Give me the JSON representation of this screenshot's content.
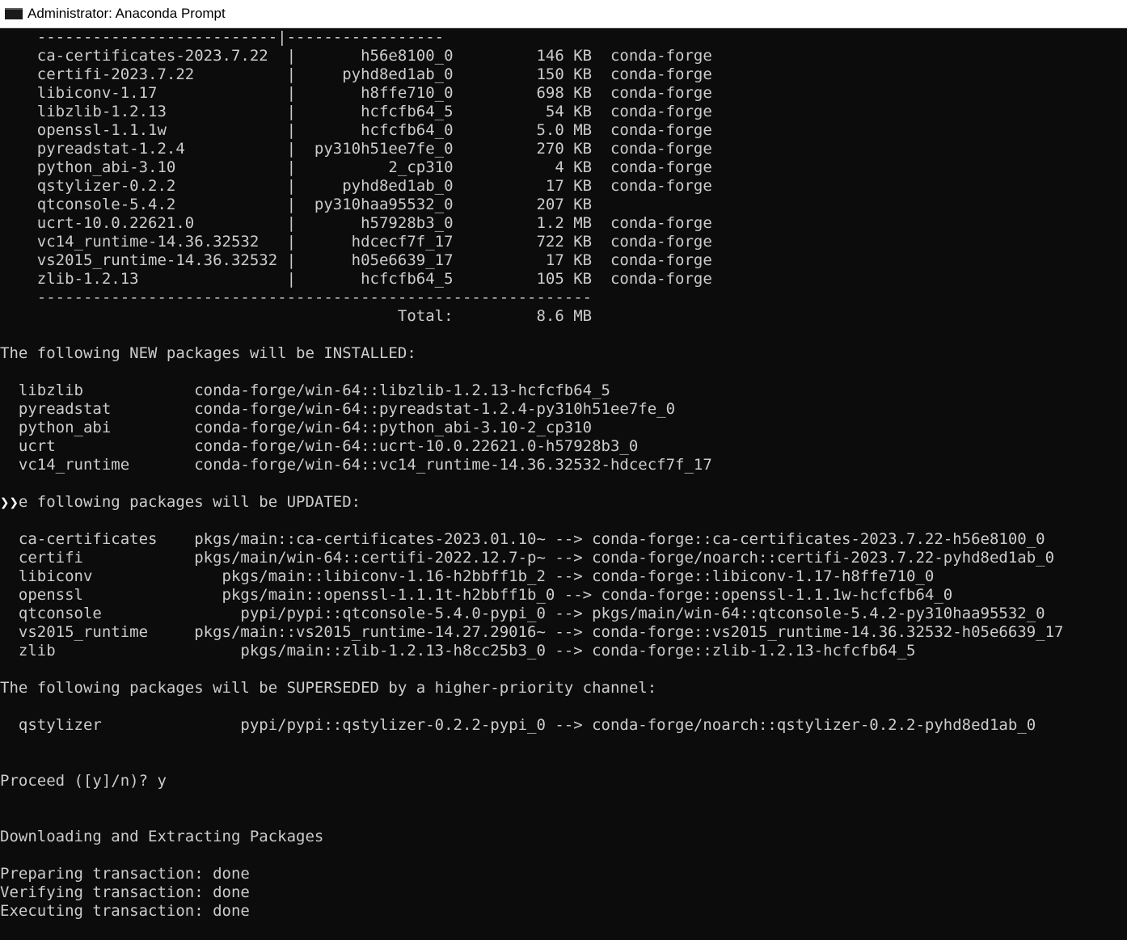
{
  "window": {
    "title": "Administrator: Anaconda Prompt"
  },
  "console": {
    "lines": [
      "    --------------------------|-----------------",
      "    ca-certificates-2023.7.22  |       h56e8100_0         146 KB  conda-forge",
      "    certifi-2023.7.22          |     pyhd8ed1ab_0         150 KB  conda-forge",
      "    libiconv-1.17              |       h8ffe710_0         698 KB  conda-forge",
      "    libzlib-1.2.13             |       hcfcfb64_5          54 KB  conda-forge",
      "    openssl-1.1.1w             |       hcfcfb64_0         5.0 MB  conda-forge",
      "    pyreadstat-1.2.4           |  py310h51ee7fe_0         270 KB  conda-forge",
      "    python_abi-3.10            |          2_cp310           4 KB  conda-forge",
      "    qstylizer-0.2.2            |     pyhd8ed1ab_0          17 KB  conda-forge",
      "    qtconsole-5.4.2            |  py310haa95532_0         207 KB",
      "    ucrt-10.0.22621.0          |       h57928b3_0         1.2 MB  conda-forge",
      "    vc14_runtime-14.36.32532   |      hdcecf7f_17         722 KB  conda-forge",
      "    vs2015_runtime-14.36.32532 |      h05e6639_17          17 KB  conda-forge",
      "    zlib-1.2.13                |       hcfcfb64_5         105 KB  conda-forge",
      "    ------------------------------------------------------------",
      "                                           Total:         8.6 MB",
      "",
      "The following NEW packages will be INSTALLED:",
      "",
      "  libzlib            conda-forge/win-64::libzlib-1.2.13-hcfcfb64_5",
      "  pyreadstat         conda-forge/win-64::pyreadstat-1.2.4-py310h51ee7fe_0",
      "  python_abi         conda-forge/win-64::python_abi-3.10-2_cp310",
      "  ucrt               conda-forge/win-64::ucrt-10.0.22621.0-h57928b3_0",
      "  vc14_runtime       conda-forge/win-64::vc14_runtime-14.36.32532-hdcecf7f_17",
      "",
      "  e following packages will be UPDATED:",
      "",
      "  ca-certificates    pkgs/main::ca-certificates-2023.01.10~ --> conda-forge::ca-certificates-2023.7.22-h56e8100_0",
      "  certifi            pkgs/main/win-64::certifi-2022.12.7-p~ --> conda-forge/noarch::certifi-2023.7.22-pyhd8ed1ab_0",
      "  libiconv              pkgs/main::libiconv-1.16-h2bbff1b_2 --> conda-forge::libiconv-1.17-h8ffe710_0",
      "  openssl               pkgs/main::openssl-1.1.1t-h2bbff1b_0 --> conda-forge::openssl-1.1.1w-hcfcfb64_0",
      "  qtconsole               pypi/pypi::qtconsole-5.4.0-pypi_0 --> pkgs/main/win-64::qtconsole-5.4.2-py310haa95532_0",
      "  vs2015_runtime     pkgs/main::vs2015_runtime-14.27.29016~ --> conda-forge::vs2015_runtime-14.36.32532-h05e6639_17",
      "  zlib                    pkgs/main::zlib-1.2.13-h8cc25b3_0 --> conda-forge::zlib-1.2.13-hcfcfb64_5",
      "",
      "The following packages will be SUPERSEDED by a higher-priority channel:",
      "",
      "  qstylizer               pypi/pypi::qstylizer-0.2.2-pypi_0 --> conda-forge/noarch::qstylizer-0.2.2-pyhd8ed1ab_0",
      "",
      "",
      "Proceed ([y]/n)? y",
      "",
      "",
      "Downloading and Extracting Packages",
      "",
      "Preparing transaction: done",
      "Verifying transaction: done",
      "Executing transaction: done"
    ],
    "cursor_glyph": "❯❯"
  }
}
